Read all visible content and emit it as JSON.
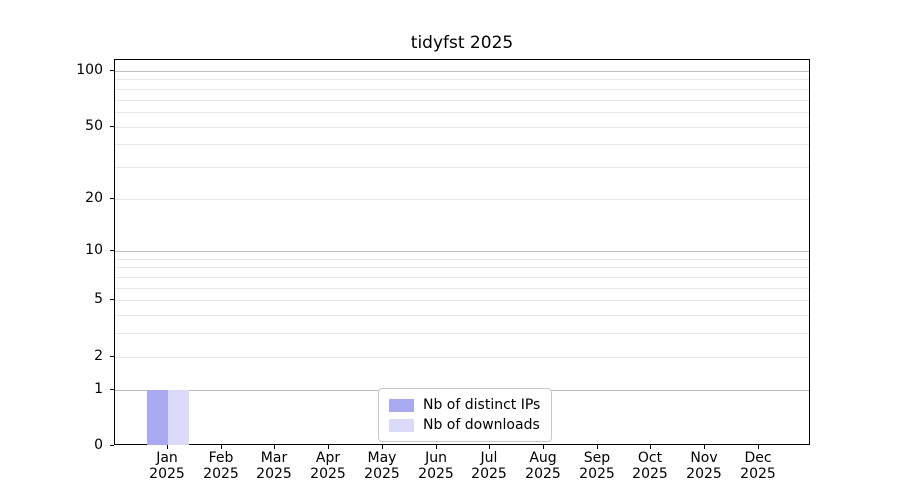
{
  "chart_data": {
    "type": "bar",
    "title": "tidyfst 2025",
    "categories": [
      "Jan 2025",
      "Feb 2025",
      "Mar 2025",
      "Apr 2025",
      "May 2025",
      "Jun 2025",
      "Jul 2025",
      "Aug 2025",
      "Sep 2025",
      "Oct 2025",
      "Nov 2025",
      "Dec 2025"
    ],
    "x_tick_lines": [
      [
        "Jan",
        "2025"
      ],
      [
        "Feb",
        "2025"
      ],
      [
        "Mar",
        "2025"
      ],
      [
        "Apr",
        "2025"
      ],
      [
        "May",
        "2025"
      ],
      [
        "Jun",
        "2025"
      ],
      [
        "Jul",
        "2025"
      ],
      [
        "Aug",
        "2025"
      ],
      [
        "Sep",
        "2025"
      ],
      [
        "Oct",
        "2025"
      ],
      [
        "Nov",
        "2025"
      ],
      [
        "Dec",
        "2025"
      ]
    ],
    "series": [
      {
        "name": "Nb of distinct IPs",
        "color": "#a9a9f2",
        "values": [
          1,
          0,
          0,
          0,
          0,
          0,
          0,
          0,
          0,
          0,
          0,
          0
        ]
      },
      {
        "name": "Nb of downloads",
        "color": "#dbdaf8",
        "values": [
          1,
          0,
          0,
          0,
          0,
          0,
          0,
          0,
          0,
          0,
          0,
          0
        ]
      }
    ],
    "xlabel": "",
    "ylabel": "",
    "yscale": "log1p",
    "ylim": [
      0,
      115
    ],
    "yticks": [
      0,
      1,
      2,
      5,
      10,
      20,
      50,
      100
    ],
    "major_gridlines": [
      1,
      10,
      100
    ],
    "minor_gridlines": [
      2,
      3,
      4,
      5,
      6,
      7,
      8,
      9,
      20,
      30,
      40,
      50,
      60,
      70,
      80,
      90
    ],
    "grid": "horizontal",
    "legend": {
      "position": "lower center",
      "items": [
        "Nb of distinct IPs",
        "Nb of downloads"
      ]
    },
    "colors": {
      "bar_distinct_ips": "#a9a9f2",
      "bar_downloads": "#dbdaf8",
      "grid_major": "#bebebe",
      "grid_minor": "#e9e9e9",
      "axis": "#000000",
      "text": "#000000",
      "legend_border": "#c9c9c9",
      "background": "#ffffff"
    }
  }
}
